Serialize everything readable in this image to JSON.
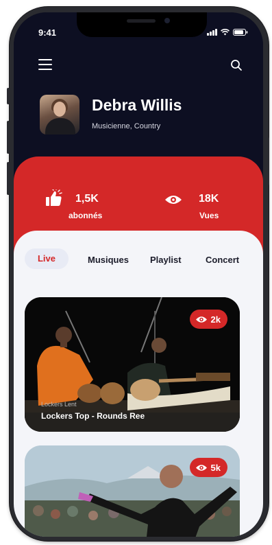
{
  "status_bar": {
    "time": "9:41"
  },
  "header": {
    "menu_icon": "menu-icon",
    "search_icon": "search-icon"
  },
  "profile": {
    "name": "Debra Willis",
    "subtitle": "Musicienne, Country"
  },
  "stats": {
    "followers": {
      "value": "1,5K",
      "label": "abonnés",
      "icon": "thumbs-up-icon"
    },
    "views": {
      "value": "18K",
      "label": "Vues",
      "icon": "eye-icon"
    }
  },
  "tabs": [
    {
      "label": "Live",
      "active": true
    },
    {
      "label": "Musiques",
      "active": false
    },
    {
      "label": "Playlist",
      "active": false
    },
    {
      "label": "Concert",
      "active": false
    }
  ],
  "cards": [
    {
      "views": "2k",
      "subtitle": "Lockers Lent",
      "title": "Lockers Top - Rounds Ree"
    },
    {
      "views": "5k"
    }
  ],
  "colors": {
    "accent": "#d42828",
    "dark": "#0d0f22",
    "content_bg": "#f4f5f9"
  }
}
